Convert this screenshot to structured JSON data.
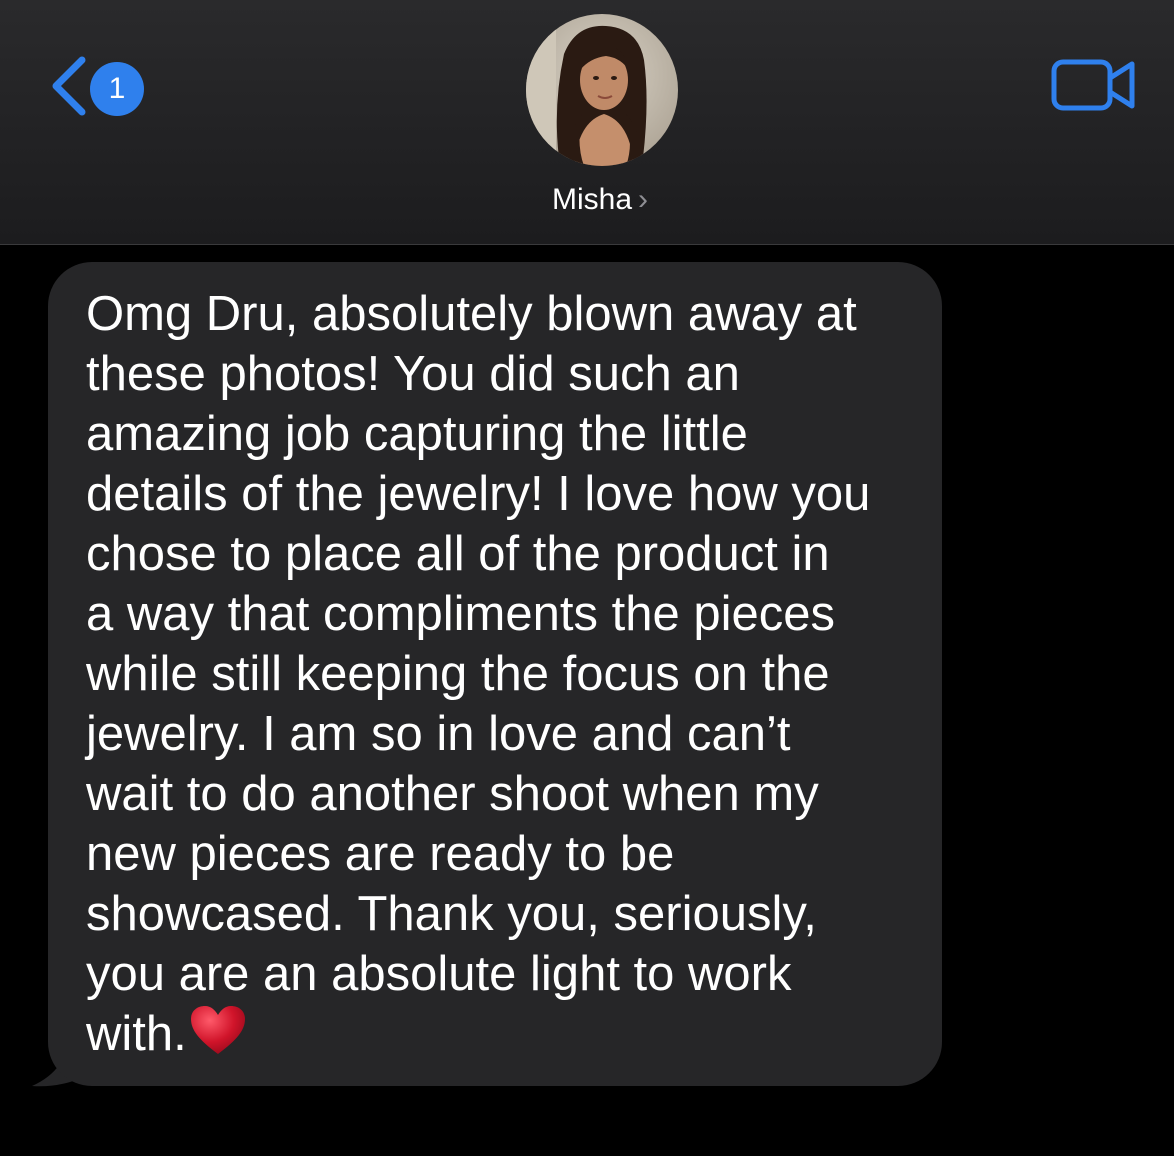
{
  "header": {
    "back_badge_count": "1",
    "contact_name": "Misha",
    "contact_chevron": "›",
    "back_icon": "chevron-left-icon",
    "video_icon": "video-camera-icon"
  },
  "message": {
    "direction": "received",
    "text": "Omg Dru, absolutely blown away at\nthese photos! You did such an\namazing job capturing the little\ndetails of the jewelry! I love how you\nchose to place all of the product in\na way that compliments the pieces\nwhile still keeping the focus on the\njewelry. I am so in love and can’t\nwait to do another shoot when my\nnew pieces are ready to be\nshowcased. Thank you, seriously,\nyou are an absolute light to work\nwith.",
    "emoji": "heart-emoji"
  },
  "colors": {
    "accent": "#2f80ed",
    "bubble": "#262628",
    "background": "#000000",
    "header": "#1c1c1e",
    "heart": "#d0142a"
  }
}
